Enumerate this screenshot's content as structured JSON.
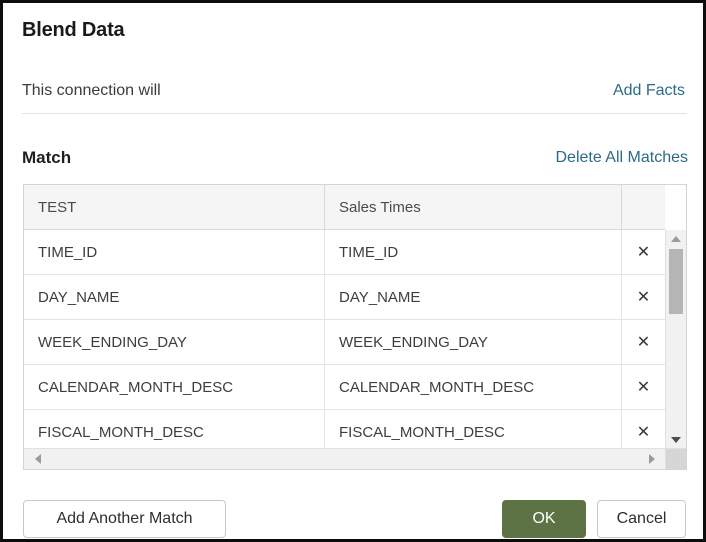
{
  "dialog": {
    "title": "Blend Data",
    "connection_text": "This connection will",
    "add_facts_label": "Add Facts",
    "match_label": "Match",
    "delete_all_label": "Delete All Matches"
  },
  "table": {
    "columns": [
      "TEST",
      "Sales Times",
      ""
    ],
    "remove_icon": "✕",
    "rows": [
      {
        "left": "TIME_ID",
        "right": "TIME_ID"
      },
      {
        "left": "DAY_NAME",
        "right": "DAY_NAME"
      },
      {
        "left": "WEEK_ENDING_DAY",
        "right": "WEEK_ENDING_DAY"
      },
      {
        "left": "CALENDAR_MONTH_DESC",
        "right": "CALENDAR_MONTH_DESC"
      },
      {
        "left": "FISCAL_MONTH_DESC",
        "right": "FISCAL_MONTH_DESC"
      }
    ]
  },
  "footer": {
    "add_another_label": "Add Another Match",
    "ok_label": "OK",
    "cancel_label": "Cancel"
  },
  "colors": {
    "link": "#2c6b87",
    "primary_button": "#5d7245",
    "border": "#0d0d0d",
    "header_bg": "#f5f5f5"
  }
}
